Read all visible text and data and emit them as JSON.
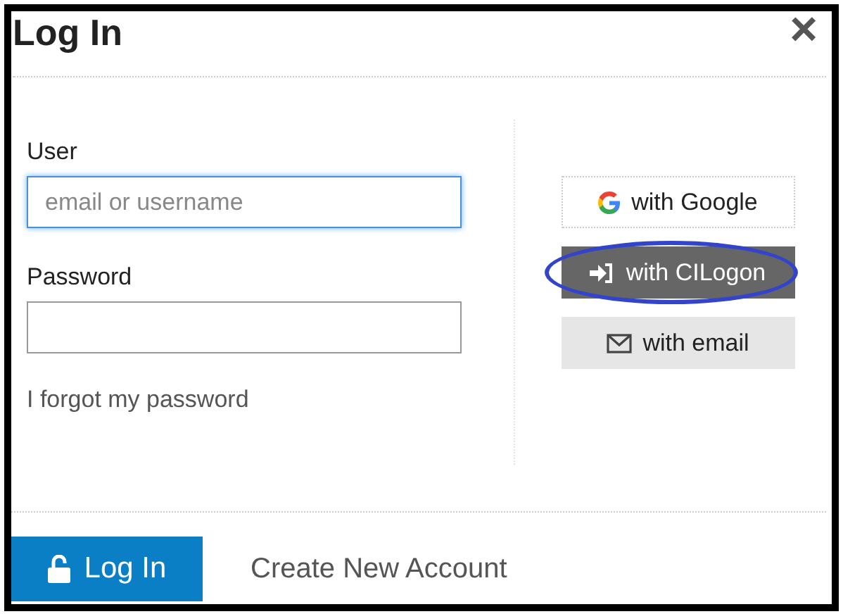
{
  "dialog": {
    "title": "Log In",
    "close": "×"
  },
  "fields": [
    {
      "label": "User",
      "placeholder": "email or username",
      "focused": true
    },
    {
      "label": "Password",
      "focused": false
    }
  ],
  "forgot_link": "I forgot my password",
  "providers": [
    {
      "kind": "google",
      "label": "with Google",
      "highlighted": false
    },
    {
      "kind": "cilogon",
      "label": "with CILogon",
      "highlighted": true
    },
    {
      "kind": "email",
      "label": "with email",
      "highlighted": false
    }
  ],
  "footer": {
    "login_button": "Log In",
    "create_account_link": "Create New Account"
  }
}
